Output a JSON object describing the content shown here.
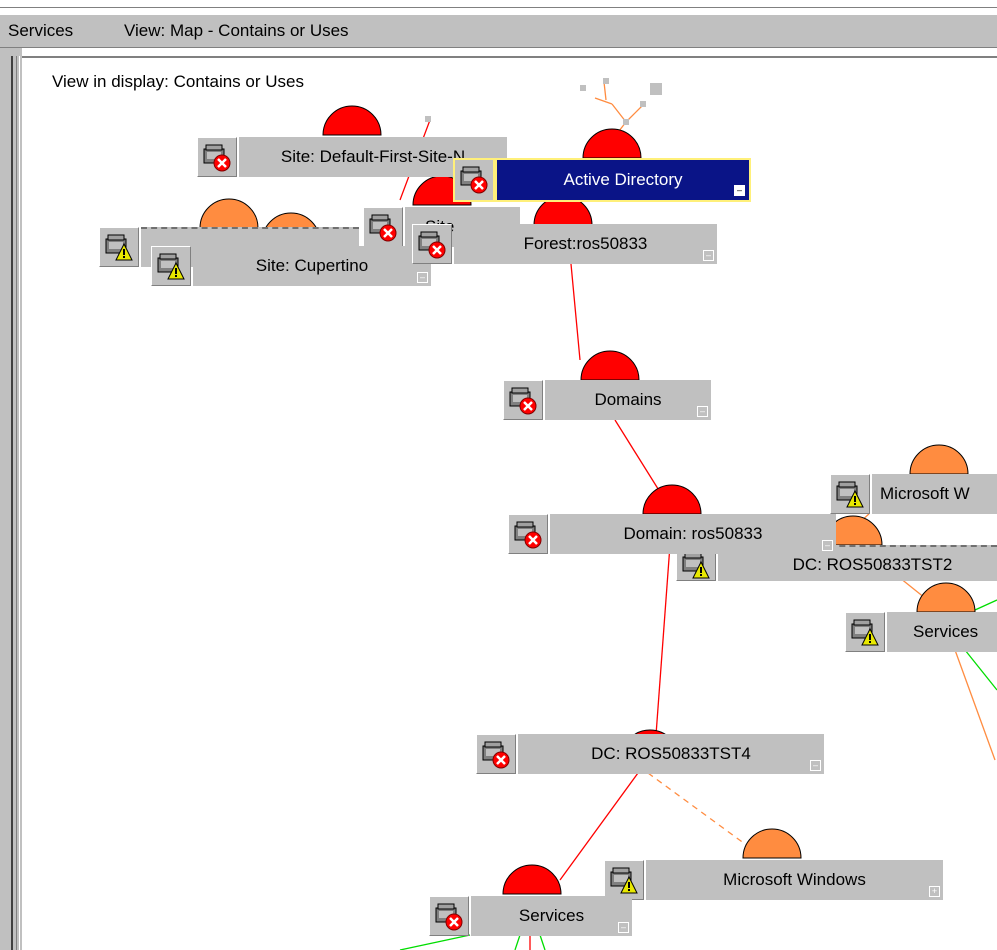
{
  "toolbar": {
    "menu_services": "Services",
    "view_title": "View: Map - Contains or Uses"
  },
  "view_label": "View in display: Contains or Uses",
  "colors": {
    "critical": "#ff0000",
    "warning": "#ff8c40",
    "selected_bg": "#0a1487",
    "selected_border": "#fff07a",
    "ok_link": "#00cc00"
  },
  "nodes": {
    "site_default": {
      "label": "Site: Default-First-Site-N",
      "status": "critical"
    },
    "active_directory": {
      "label": "Active Directory",
      "status": "critical",
      "selected": true
    },
    "site_partial": {
      "label": "Site",
      "status": "critical"
    },
    "site_hidden": {
      "label": "Site: ...",
      "status": "warning"
    },
    "forest": {
      "label": "Forest:ros50833",
      "status": "critical"
    },
    "site_cupertino": {
      "label": "Site: Cupertino",
      "status": "warning"
    },
    "domains": {
      "label": "Domains",
      "status": "critical"
    },
    "domain": {
      "label": "Domain: ros50833",
      "status": "critical"
    },
    "microsoft_w_right": {
      "label": "Microsoft W",
      "status": "warning"
    },
    "dc_tst2": {
      "label": "DC: ROS50833TST2",
      "status": "warning"
    },
    "services_right": {
      "label": "Services",
      "status": "warning"
    },
    "dc_tst4": {
      "label": "DC: ROS50833TST4",
      "status": "critical"
    },
    "microsoft_windows": {
      "label": "Microsoft Windows",
      "status": "warning"
    },
    "services_bottom": {
      "label": "Services",
      "status": "critical"
    }
  },
  "icons": {
    "critical": "critical-status-icon",
    "warning": "warning-status-icon",
    "collapse": "minus",
    "expand": "plus"
  }
}
